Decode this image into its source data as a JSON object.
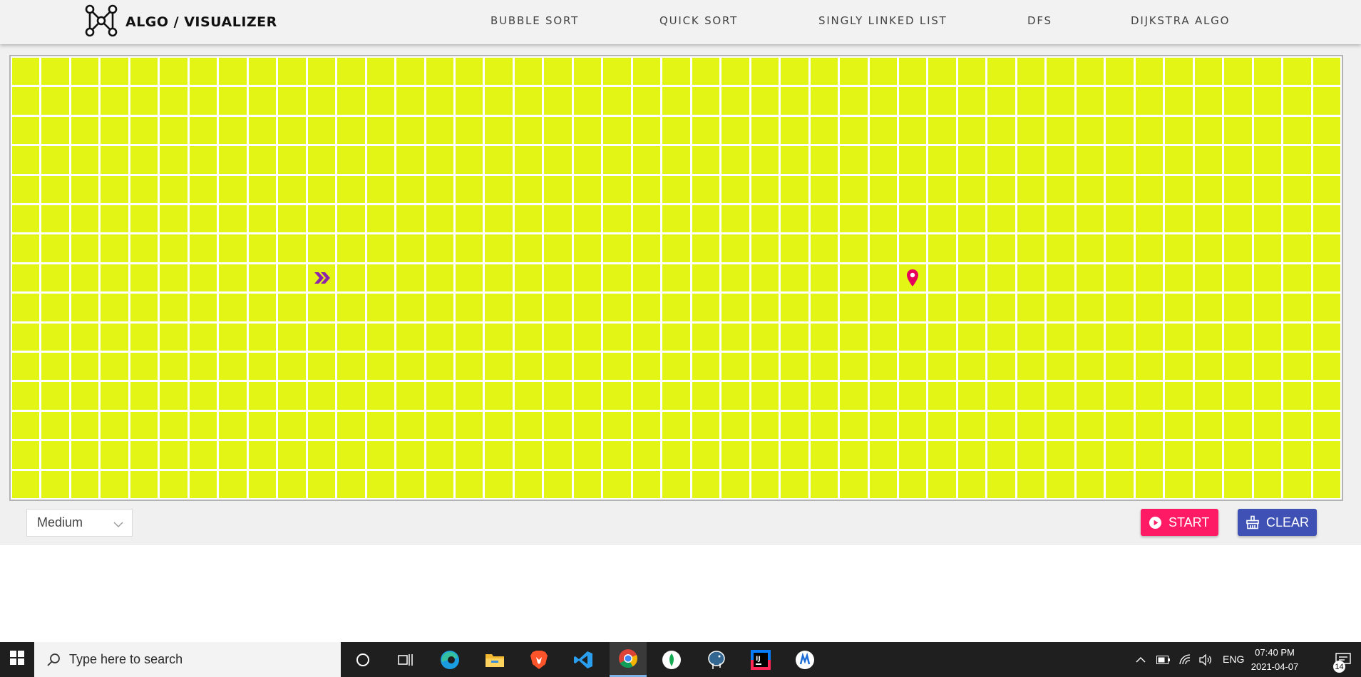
{
  "header": {
    "brand_title": "ALGO / VISUALIZER",
    "nav": [
      {
        "label": "BUBBLE SORT"
      },
      {
        "label": "QUICK SORT"
      },
      {
        "label": "SINGLY LINKED LIST"
      },
      {
        "label": "DFS"
      },
      {
        "label": "DIJKSTRA ALGO"
      }
    ]
  },
  "grid": {
    "rows": 15,
    "cols": 45,
    "cell_color": "#e3f515",
    "start_node": {
      "row": 8,
      "col": 11,
      "icon": "double-chevron-right-icon",
      "color": "#8e24aa"
    },
    "target_node": {
      "row": 8,
      "col": 31,
      "icon": "map-pin-icon",
      "color": "#e6005c"
    }
  },
  "controls": {
    "speed_select": {
      "value": "Medium"
    },
    "start_button": {
      "label": "START",
      "icon": "play-circle-icon",
      "color": "#ff1a66"
    },
    "clear_button": {
      "label": "CLEAR",
      "icon": "broom-icon",
      "color": "#3f51b5"
    }
  },
  "taskbar": {
    "search_placeholder": "Type here to search",
    "language": "ENG",
    "time": "07:40 PM",
    "date": "2021-04-07",
    "notification_count": "14",
    "apps": [
      "cortana-icon",
      "task-view-icon",
      "edge-icon",
      "file-explorer-icon",
      "brave-icon",
      "vscode-icon",
      "chrome-icon",
      "mongodb-compass-icon",
      "postgresql-icon",
      "intellij-icon",
      "app-icon"
    ],
    "active_app": "chrome-icon"
  }
}
